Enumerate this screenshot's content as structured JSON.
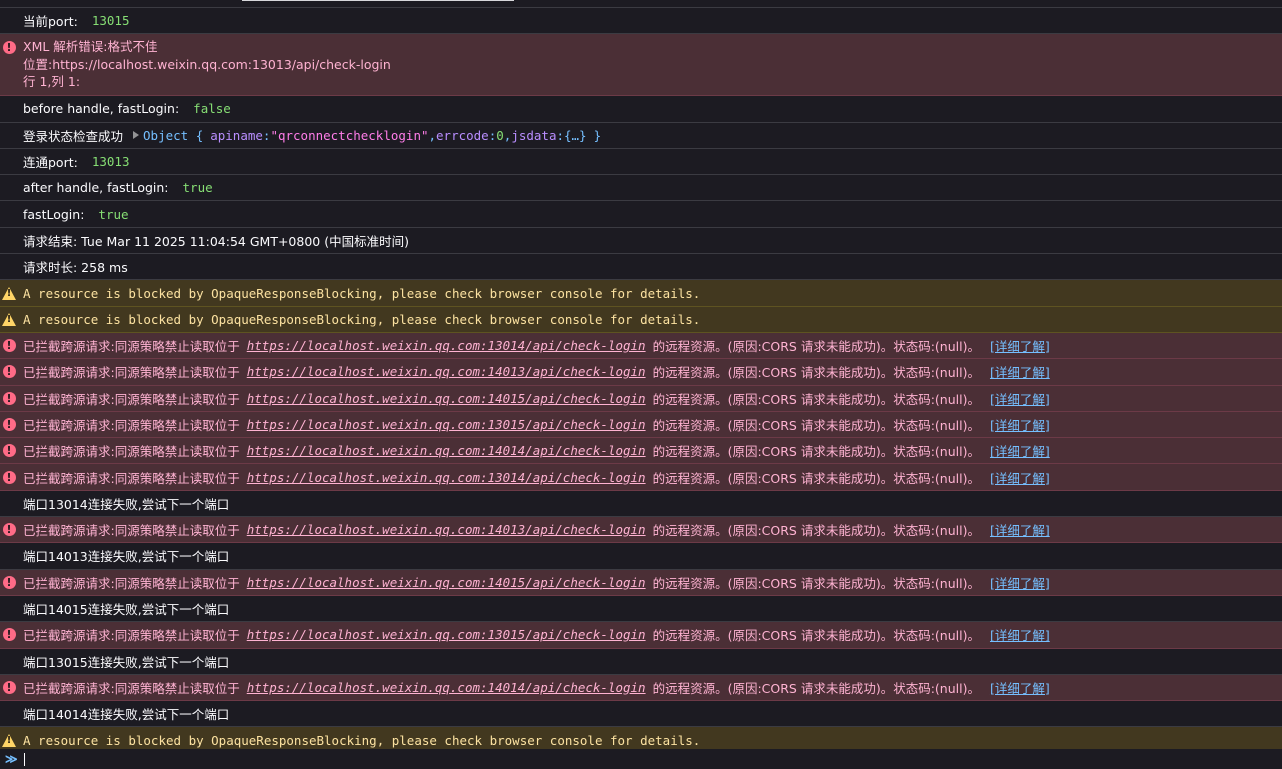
{
  "entries": [
    {
      "type": "log",
      "label": "当前port:",
      "value": "13015"
    },
    {
      "type": "error-multi",
      "line1": "XML 解析错误:格式不佳",
      "line2": "位置:https://localhost.weixin.qq.com:13013/api/check-login",
      "line3": "行 1,列 1:"
    },
    {
      "type": "log",
      "label": "before handle, fastLogin:",
      "value": "false"
    },
    {
      "type": "log-obj",
      "label": "登录状态检查成功",
      "obj_prefix": "Object {",
      "k1": "apiname",
      "v1": "\"qrconnectchecklogin\"",
      "k2": "errcode",
      "v2": "0",
      "k3": "jsdata",
      "v3": "{…}",
      "obj_suffix": "}"
    },
    {
      "type": "log",
      "label": "连通port:",
      "value": "13013"
    },
    {
      "type": "log",
      "label": "after handle, fastLogin:",
      "value": "true"
    },
    {
      "type": "log",
      "label": "fastLogin:",
      "value": "true"
    },
    {
      "type": "text",
      "text": "请求结束: Tue Mar 11 2025 11:04:54 GMT+0800 (中国标准时间)"
    },
    {
      "type": "text",
      "text": "请求时长: 258 ms"
    },
    {
      "type": "warn",
      "text": "A resource is blocked by OpaqueResponseBlocking, please check browser console for details."
    },
    {
      "type": "warn",
      "text": "A resource is blocked by OpaqueResponseBlocking, please check browser console for details."
    },
    {
      "type": "cors",
      "url": "https://localhost.weixin.qq.com:13014/api/check-login"
    },
    {
      "type": "cors",
      "url": "https://localhost.weixin.qq.com:14013/api/check-login"
    },
    {
      "type": "cors",
      "url": "https://localhost.weixin.qq.com:14015/api/check-login"
    },
    {
      "type": "cors",
      "url": "https://localhost.weixin.qq.com:13015/api/check-login"
    },
    {
      "type": "cors",
      "url": "https://localhost.weixin.qq.com:14014/api/check-login"
    },
    {
      "type": "cors",
      "url": "https://localhost.weixin.qq.com:13014/api/check-login"
    },
    {
      "type": "text",
      "text": "端口13014连接失败,尝试下一个端口"
    },
    {
      "type": "cors",
      "url": "https://localhost.weixin.qq.com:14013/api/check-login"
    },
    {
      "type": "text",
      "text": "端口14013连接失败,尝试下一个端口"
    },
    {
      "type": "cors",
      "url": "https://localhost.weixin.qq.com:14015/api/check-login"
    },
    {
      "type": "text",
      "text": "端口14015连接失败,尝试下一个端口"
    },
    {
      "type": "cors",
      "url": "https://localhost.weixin.qq.com:13015/api/check-login"
    },
    {
      "type": "text",
      "text": "端口13015连接失败,尝试下一个端口"
    },
    {
      "type": "cors",
      "url": "https://localhost.weixin.qq.com:14014/api/check-login"
    },
    {
      "type": "text",
      "text": "端口14014连接失败,尝试下一个端口"
    },
    {
      "type": "warn",
      "text": "A resource is blocked by OpaqueResponseBlocking, please check browser console for details."
    }
  ],
  "cors_text": {
    "prefix": "已拦截跨源请求:同源策略禁止读取位于",
    "suffix": "的远程资源。(原因:CORS 请求未能成功)。状态码:(null)。",
    "learn_more": "[详细了解]"
  },
  "icons": {
    "error": "error-icon",
    "warning": "warning-icon",
    "expand": "expand-triangle-icon",
    "prompt": "prompt-chevron-icon"
  },
  "prompt": {
    "symbol": "≫"
  },
  "colors": {
    "background": "#1c1b22",
    "error_bg": "#4b2f36",
    "warning_bg": "#42381f",
    "number": "#86de74",
    "link": "#75bfff"
  }
}
